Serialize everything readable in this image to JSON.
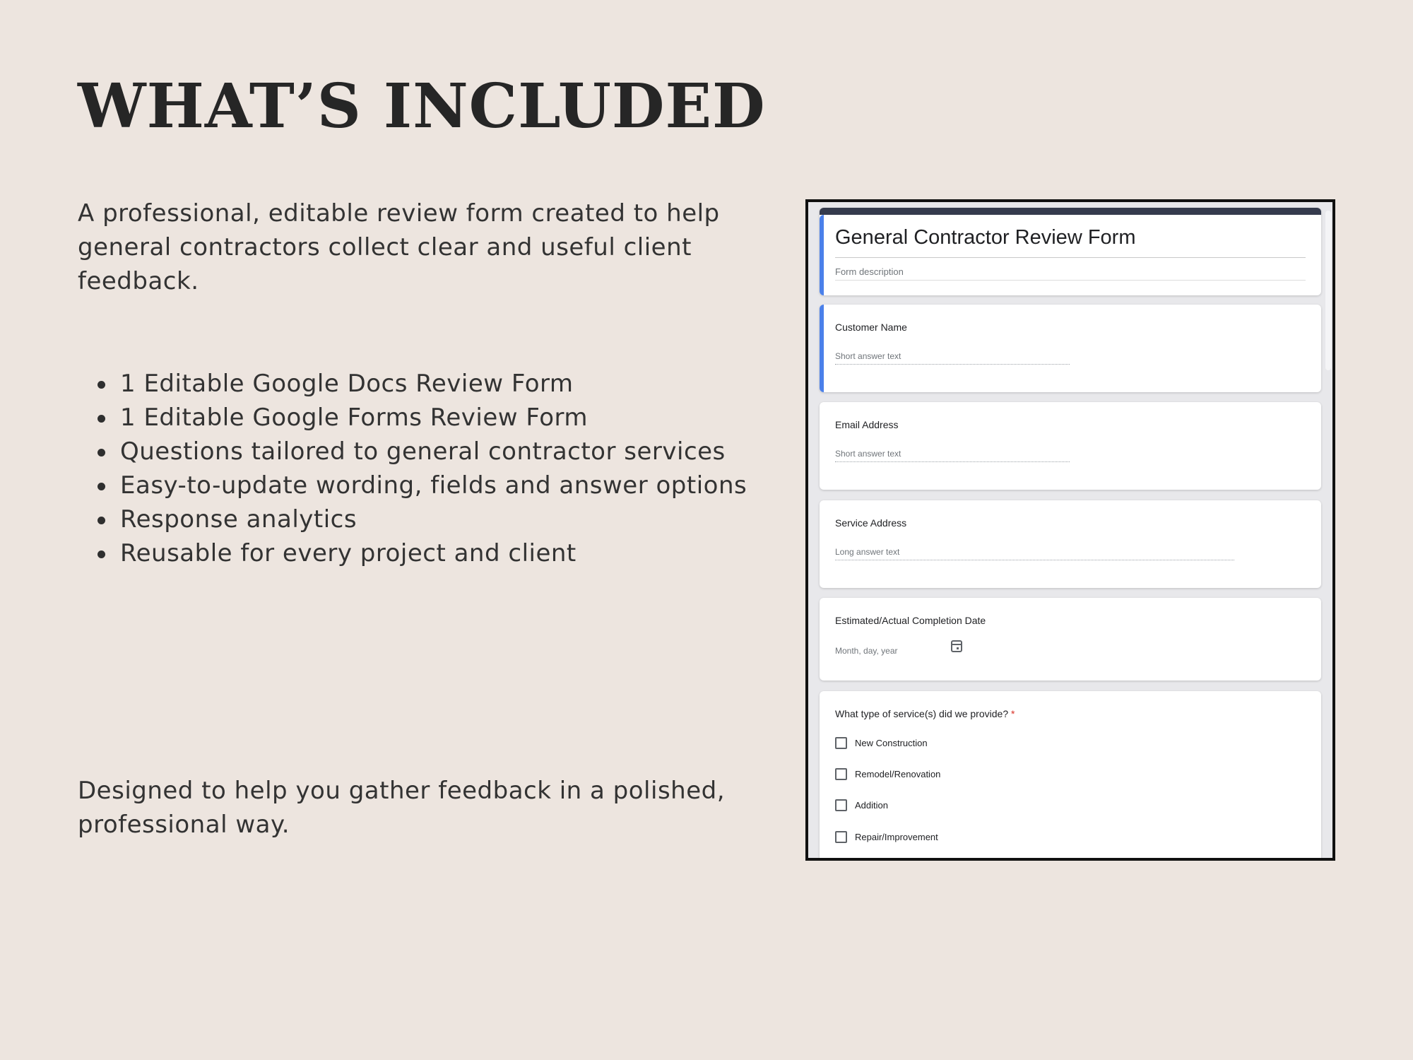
{
  "heading": "WHAT’S INCLUDED",
  "intro": "A professional, editable review form created to help general contractors collect clear and useful client feedback.",
  "bullets": [
    "1 Editable Google Docs Review Form",
    "1 Editable Google Forms Review Form",
    "Questions tailored to general contractor services",
    "Easy-to-update wording, fields and answer options",
    "Response analytics",
    "Reusable for every project and client"
  ],
  "outro": "Designed to help you gather feedback in a polished, professional way.",
  "form": {
    "title": "General Contractor Review Form",
    "description_placeholder": "Form description",
    "accent_color": "#4a80ea",
    "header_color": "#353b4d",
    "questions": [
      {
        "label": "Customer Name",
        "hint": "Short answer text"
      },
      {
        "label": "Email Address",
        "hint": "Short answer text"
      },
      {
        "label": "Service Address",
        "hint": "Long answer text"
      },
      {
        "label": "Estimated/Actual Completion Date",
        "hint": "Month, day, year"
      }
    ],
    "checkbox_question": {
      "label": "What type of service(s) did we provide?",
      "required_mark": "*",
      "options": [
        "New Construction",
        "Remodel/Renovation",
        "Addition",
        "Repair/Improvement"
      ]
    }
  }
}
